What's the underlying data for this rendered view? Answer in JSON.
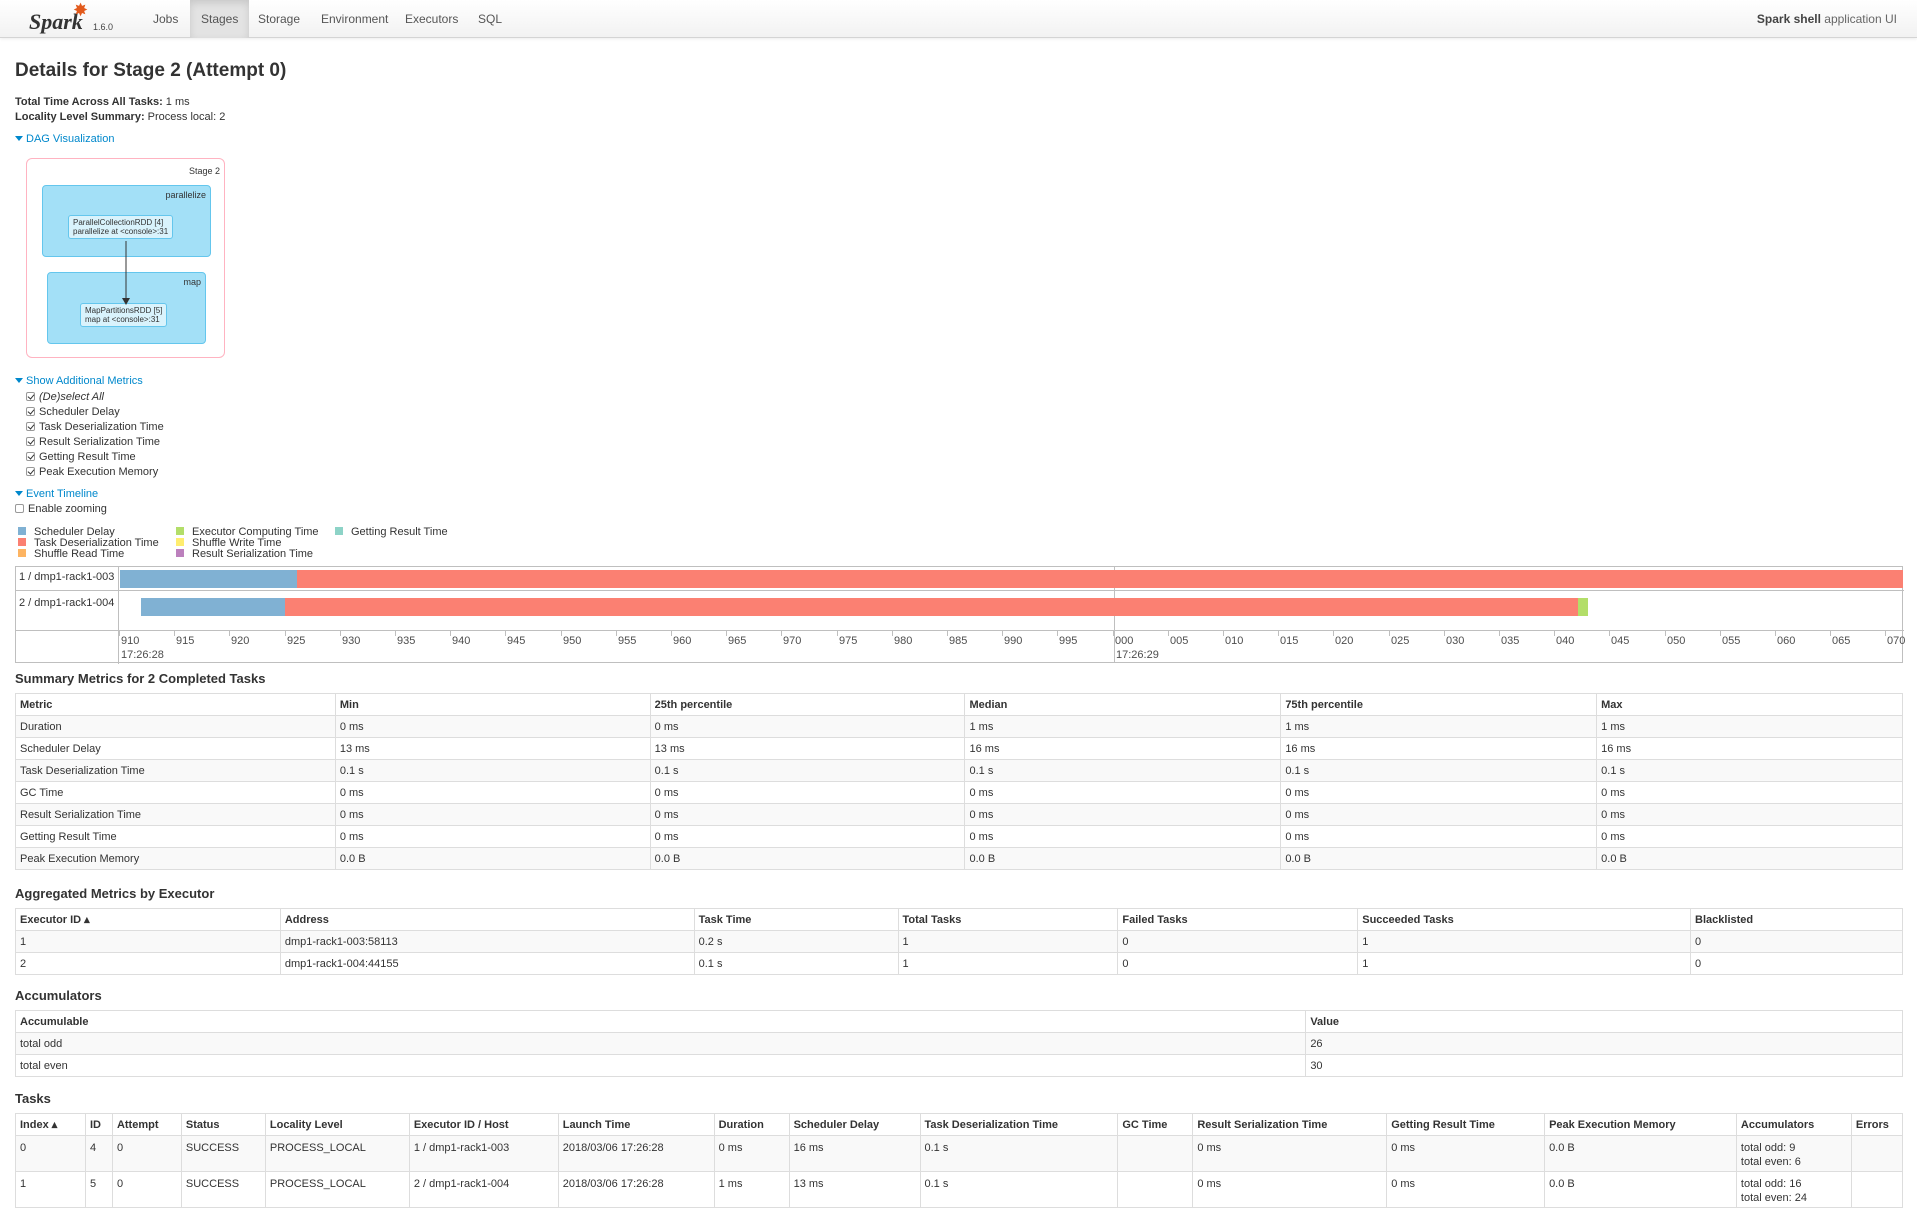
{
  "nav": {
    "brand": "Spark",
    "version": "1.6.0",
    "items": [
      "Jobs",
      "Stages",
      "Storage",
      "Environment",
      "Executors",
      "SQL"
    ],
    "active": "Stages",
    "app_name_bold": "Spark shell",
    "app_name_suffix": "application UI"
  },
  "page": {
    "title": "Details for Stage 2 (Attempt 0)",
    "total_time_label": "Total Time Across All Tasks:",
    "total_time_value": "1 ms",
    "locality_label": "Locality Level Summary:",
    "locality_value": "Process local: 2"
  },
  "dag": {
    "toggle": "DAG Visualization",
    "stage_label": "Stage 2",
    "clusters": [
      {
        "label": "parallelize",
        "node_line1": "ParallelCollectionRDD [4]",
        "node_line2": "parallelize at <console>:31"
      },
      {
        "label": "map",
        "node_line1": "MapPartitionsRDD [5]",
        "node_line2": "map at <console>:31"
      }
    ]
  },
  "metrics_toggle": {
    "label": "Show Additional Metrics",
    "items": [
      "(De)select All",
      "Scheduler Delay",
      "Task Deserialization Time",
      "Result Serialization Time",
      "Getting Result Time",
      "Peak Execution Memory"
    ]
  },
  "timeline": {
    "toggle": "Event Timeline",
    "zoom_label": "Enable zooming",
    "legend": [
      {
        "label": "Scheduler Delay",
        "color": "#80b1d3"
      },
      {
        "label": "Task Deserialization Time",
        "color": "#fb8072"
      },
      {
        "label": "Shuffle Read Time",
        "color": "#fdb462"
      },
      {
        "label": "Executor Computing Time",
        "color": "#b3de69"
      },
      {
        "label": "Shuffle Write Time",
        "color": "#ffed6f"
      },
      {
        "label": "Result Serialization Time",
        "color": "#bc80bd"
      },
      {
        "label": "Getting Result Time",
        "color": "#8dd3c7"
      }
    ],
    "rows": [
      "1 / dmp1-rack1-003",
      "2 / dmp1-rack1-004"
    ],
    "ticks": [
      "910",
      "915",
      "920",
      "925",
      "930",
      "935",
      "940",
      "945",
      "950",
      "955",
      "960",
      "965",
      "970",
      "975",
      "980",
      "985",
      "990",
      "995",
      "000",
      "005",
      "010",
      "015",
      "020",
      "025",
      "030",
      "035",
      "040",
      "045",
      "050",
      "055",
      "060",
      "065",
      "070"
    ],
    "major_labels": [
      "17:26:28",
      "17:26:29"
    ]
  },
  "summary": {
    "title": "Summary Metrics for 2 Completed Tasks",
    "headers": [
      "Metric",
      "Min",
      "25th percentile",
      "Median",
      "75th percentile",
      "Max"
    ],
    "rows": [
      [
        "Duration",
        "0 ms",
        "0 ms",
        "1 ms",
        "1 ms",
        "1 ms"
      ],
      [
        "Scheduler Delay",
        "13 ms",
        "13 ms",
        "16 ms",
        "16 ms",
        "16 ms"
      ],
      [
        "Task Deserialization Time",
        "0.1 s",
        "0.1 s",
        "0.1 s",
        "0.1 s",
        "0.1 s"
      ],
      [
        "GC Time",
        "0 ms",
        "0 ms",
        "0 ms",
        "0 ms",
        "0 ms"
      ],
      [
        "Result Serialization Time",
        "0 ms",
        "0 ms",
        "0 ms",
        "0 ms",
        "0 ms"
      ],
      [
        "Getting Result Time",
        "0 ms",
        "0 ms",
        "0 ms",
        "0 ms",
        "0 ms"
      ],
      [
        "Peak Execution Memory",
        "0.0 B",
        "0.0 B",
        "0.0 B",
        "0.0 B",
        "0.0 B"
      ]
    ]
  },
  "executors": {
    "title": "Aggregated Metrics by Executor",
    "headers": [
      "Executor ID ▴",
      "Address",
      "Task Time",
      "Total Tasks",
      "Failed Tasks",
      "Succeeded Tasks",
      "Blacklisted"
    ],
    "rows": [
      [
        "1",
        "dmp1-rack1-003:58113",
        "0.2 s",
        "1",
        "0",
        "1",
        "0"
      ],
      [
        "2",
        "dmp1-rack1-004:44155",
        "0.1 s",
        "1",
        "0",
        "1",
        "0"
      ]
    ]
  },
  "accumulators": {
    "title": "Accumulators",
    "headers": [
      "Accumulable",
      "Value"
    ],
    "rows": [
      [
        "total odd",
        "26"
      ],
      [
        "total even",
        "30"
      ]
    ]
  },
  "tasks": {
    "title": "Tasks",
    "headers": [
      "Index ▴",
      "ID",
      "Attempt",
      "Status",
      "Locality Level",
      "Executor ID / Host",
      "Launch Time",
      "Duration",
      "Scheduler Delay",
      "Task Deserialization Time",
      "GC Time",
      "Result Serialization Time",
      "Getting Result Time",
      "Peak Execution Memory",
      "Accumulators",
      "Errors"
    ],
    "rows": [
      [
        "0",
        "4",
        "0",
        "SUCCESS",
        "PROCESS_LOCAL",
        "1 / dmp1-rack1-003",
        "2018/03/06 17:26:28",
        "0 ms",
        "16 ms",
        "0.1 s",
        "",
        "0 ms",
        "0 ms",
        "0.0 B",
        "total odd: 9",
        "total even: 6",
        ""
      ],
      [
        "1",
        "5",
        "0",
        "SUCCESS",
        "PROCESS_LOCAL",
        "2 / dmp1-rack1-004",
        "2018/03/06 17:26:28",
        "1 ms",
        "13 ms",
        "0.1 s",
        "",
        "0 ms",
        "0 ms",
        "0.0 B",
        "total odd: 16",
        "total even: 24",
        ""
      ]
    ]
  }
}
